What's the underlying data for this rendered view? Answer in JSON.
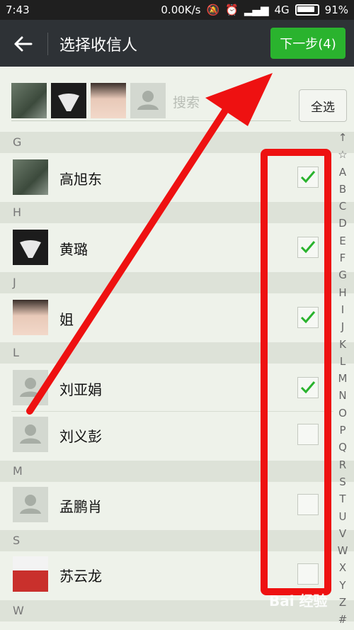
{
  "status_bar": {
    "time": "7:43",
    "network_speed": "0.00K/s",
    "network_type": "4G",
    "battery": "91%",
    "icons": [
      "mute-icon",
      "alarm-icon",
      "signal-icon",
      "battery-icon"
    ]
  },
  "app_bar": {
    "title": "选择收信人",
    "next_button": "下一步(4)",
    "back_icon": "arrow-left-icon",
    "accent": "#2ab32e"
  },
  "selected": {
    "search_placeholder": "搜索",
    "select_all": "全选"
  },
  "sections": [
    {
      "letter": "G",
      "contacts": [
        {
          "name": "高旭东",
          "checked": true
        }
      ]
    },
    {
      "letter": "H",
      "contacts": [
        {
          "name": "黄璐",
          "checked": true
        }
      ]
    },
    {
      "letter": "J",
      "contacts": [
        {
          "name": "姐",
          "checked": true
        }
      ]
    },
    {
      "letter": "L",
      "contacts": [
        {
          "name": "刘亚娟",
          "checked": true
        },
        {
          "name": "刘义彭",
          "checked": false
        }
      ]
    },
    {
      "letter": "M",
      "contacts": [
        {
          "name": "孟鹏肖",
          "checked": false
        }
      ]
    },
    {
      "letter": "S",
      "contacts": [
        {
          "name": "苏云龙",
          "checked": false
        }
      ]
    },
    {
      "letter": "W",
      "contacts": []
    }
  ],
  "index_letters": [
    "↑",
    "☆",
    "A",
    "B",
    "C",
    "D",
    "E",
    "F",
    "G",
    "H",
    "I",
    "J",
    "K",
    "L",
    "M",
    "N",
    "O",
    "P",
    "Q",
    "R",
    "S",
    "T",
    "U",
    "V",
    "W",
    "X",
    "Y",
    "Z",
    "#"
  ],
  "watermark": "Bai 经验"
}
